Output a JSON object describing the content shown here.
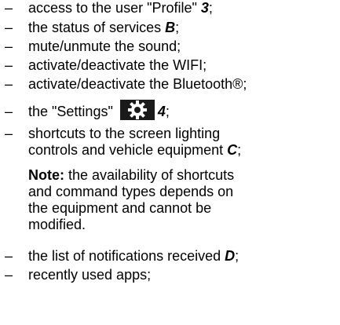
{
  "dash": "–",
  "items_top": [
    {
      "text": "access to the user \"Profile\" ",
      "ref": "3",
      "after": ";"
    },
    {
      "text": "the status of services ",
      "ref": "B",
      "after": ";"
    },
    {
      "text": "mute/unmute the sound;",
      "ref": "",
      "after": ""
    },
    {
      "text": "activate/deactivate the WIFI;",
      "ref": "",
      "after": ""
    },
    {
      "text": "activate/deactivate the Bluetooth®;",
      "ref": "",
      "after": ""
    }
  ],
  "settings_item": {
    "text": "the \"Settings\" ",
    "icon": "gear-icon",
    "ref": "4",
    "after": ";"
  },
  "shortcuts_item": {
    "line1": "shortcuts to the screen lighting",
    "line2": "controls and vehicle equipment ",
    "ref": "C",
    "after": ";"
  },
  "note": {
    "label": "Note:",
    "line1": " the availability of shortcuts",
    "line2": "and command types depends on",
    "line3": "the equipment and cannot be",
    "line4": "modified."
  },
  "items_bottom": [
    {
      "text": "the list of notifications received ",
      "ref": "D",
      "after": ";"
    },
    {
      "text": "recently used apps;",
      "ref": "",
      "after": ""
    }
  ]
}
